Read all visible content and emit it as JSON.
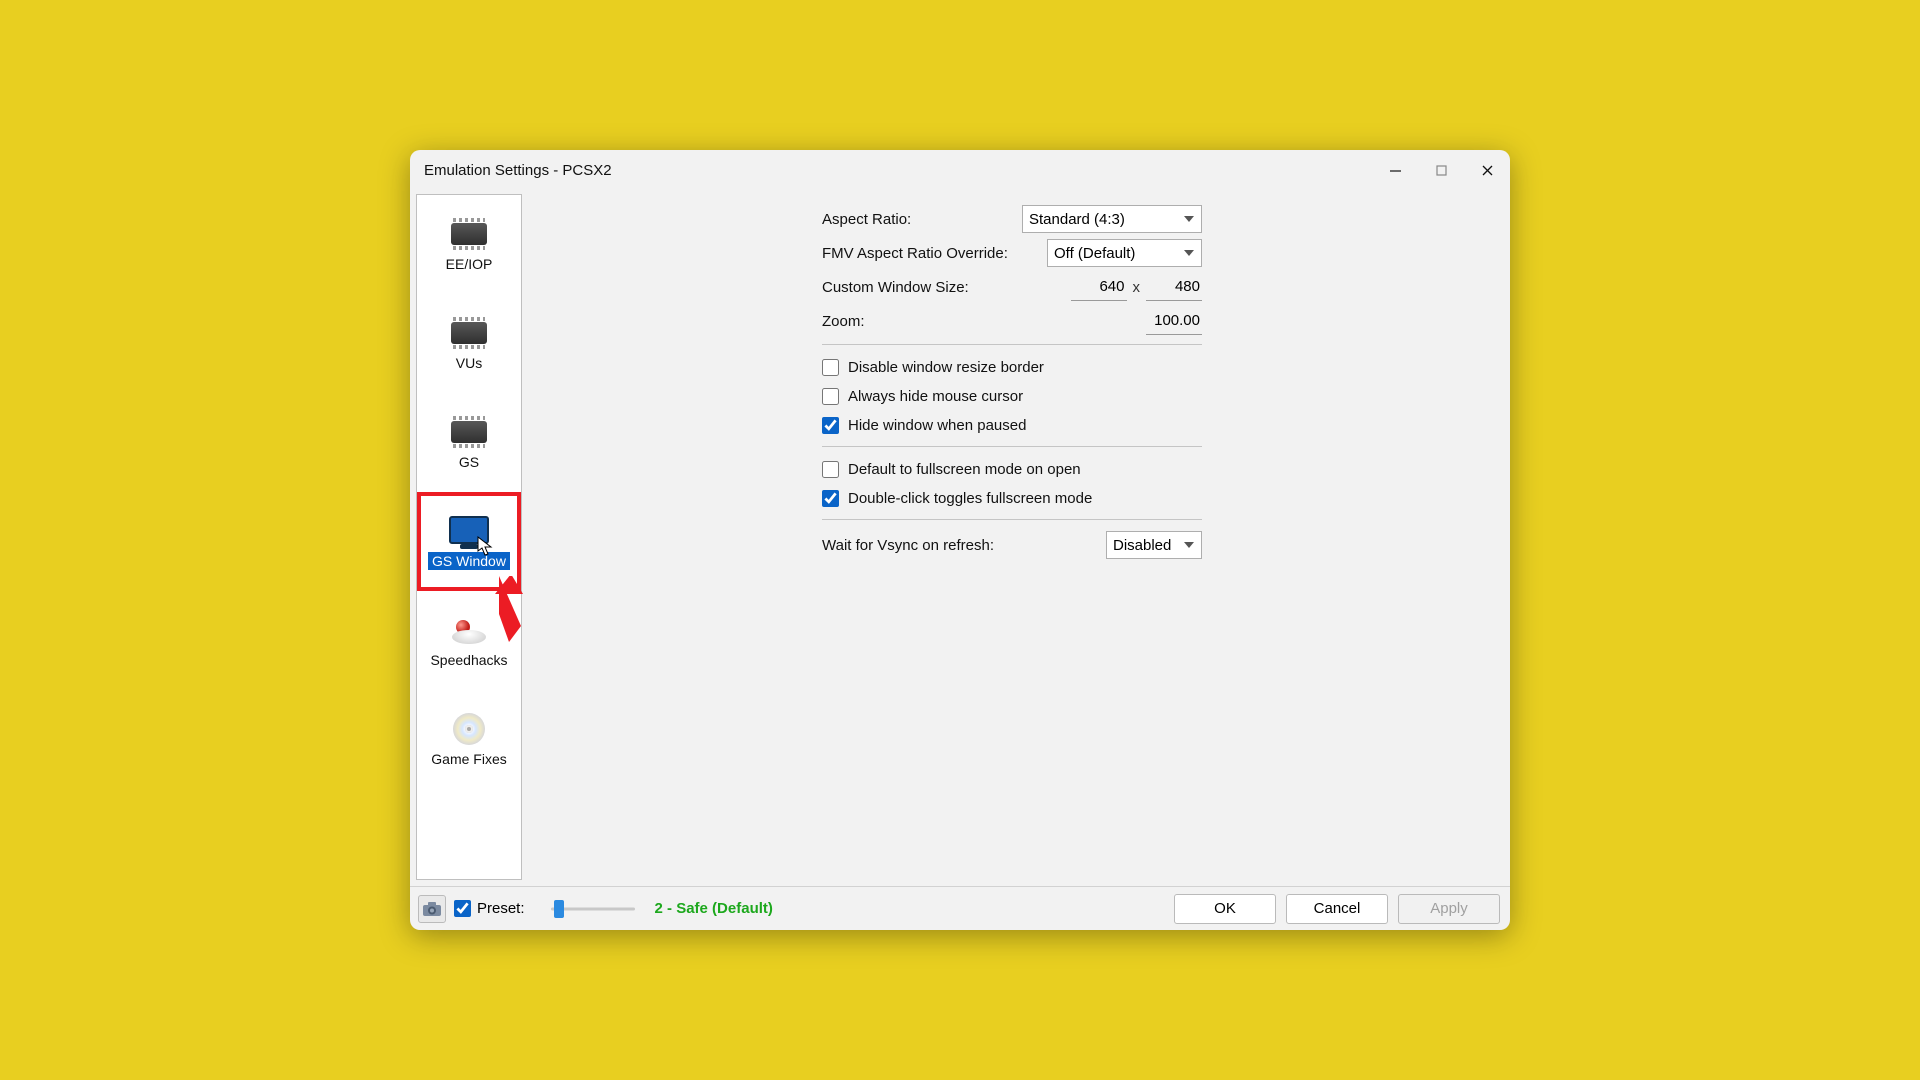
{
  "window": {
    "title": "Emulation Settings - PCSX2"
  },
  "sidebar": {
    "items": [
      {
        "label": "EE/IOP"
      },
      {
        "label": "VUs"
      },
      {
        "label": "GS"
      },
      {
        "label": "GS Window"
      },
      {
        "label": "Speedhacks"
      },
      {
        "label": "Game Fixes"
      }
    ]
  },
  "form": {
    "aspect_label": "Aspect Ratio:",
    "aspect_value": "Standard (4:3)",
    "fmv_label": "FMV Aspect Ratio Override:",
    "fmv_value": "Off (Default)",
    "cws_label": "Custom Window Size:",
    "cws_w": "640",
    "cws_x": "x",
    "cws_h": "480",
    "zoom_label": "Zoom:",
    "zoom_value": "100.00",
    "chk_disable_resize": "Disable window resize border",
    "chk_hide_cursor": "Always hide mouse cursor",
    "chk_hide_paused": "Hide window when paused",
    "chk_default_fs": "Default to fullscreen mode on open",
    "chk_dblclick_fs": "Double-click toggles fullscreen mode",
    "vsync_label": "Wait for Vsync on refresh:",
    "vsync_value": "Disabled"
  },
  "footer": {
    "preset_label": "Preset:",
    "preset_text": "2 - Safe (Default)",
    "ok": "OK",
    "cancel": "Cancel",
    "apply": "Apply"
  }
}
